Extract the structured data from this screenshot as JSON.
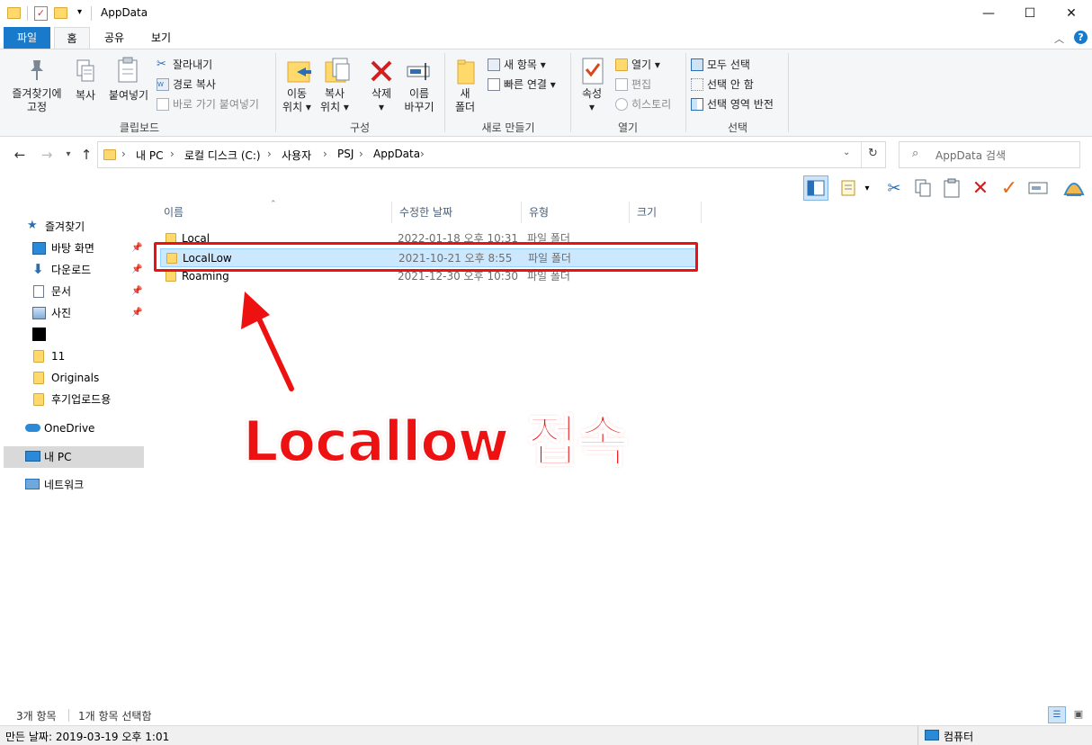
{
  "window": {
    "title": "AppData",
    "controls": {
      "minimize": "—",
      "maximize": "☐",
      "close": "✕"
    }
  },
  "ribbon_tabs": [
    {
      "label": "파일"
    },
    {
      "label": "홈"
    },
    {
      "label": "공유"
    },
    {
      "label": "보기"
    }
  ],
  "ribbon": {
    "clipboard": {
      "pin_label": "즐겨찾기에\n고정",
      "copy_label": "복사",
      "paste_label": "붙여넣기",
      "cut_label": "잘라내기",
      "copy_path_label": "경로 복사",
      "paste_shortcut_label": "바로 가기 붙여넣기",
      "group_label": "클립보드"
    },
    "organize": {
      "move_label": "이동\n위치 ▾",
      "copyto_label": "복사\n위치 ▾",
      "delete_label": "삭제\n▾",
      "rename_label": "이름\n바꾸기",
      "group_label": "구성"
    },
    "new": {
      "new_folder_label": "새\n폴더",
      "new_item_label": "새 항목 ▾",
      "easy_access_label": "빠른 연결 ▾",
      "group_label": "새로 만들기"
    },
    "open": {
      "properties_label": "속성\n▾",
      "open_label": "열기 ▾",
      "edit_label": "편집",
      "history_label": "히스토리",
      "group_label": "열기"
    },
    "select": {
      "select_all_label": "모두 선택",
      "select_none_label": "선택 안 함",
      "invert_label": "선택 영역 반전",
      "group_label": "선택"
    }
  },
  "address": {
    "crumbs": [
      "내 PC",
      "로컬 디스크 (C:)",
      "사용자",
      "PSJ",
      "AppData"
    ],
    "search_placeholder": "AppData 검색"
  },
  "sidebar": {
    "quick_access": "즐겨찾기",
    "items": [
      {
        "label": "바탕 화면",
        "pinned": true
      },
      {
        "label": "다운로드",
        "pinned": true
      },
      {
        "label": "문서",
        "pinned": true
      },
      {
        "label": "사진",
        "pinned": true
      },
      {
        "label": ""
      },
      {
        "label": "11"
      },
      {
        "label": "Originals"
      },
      {
        "label": "후기업로드용"
      }
    ],
    "onedrive": "OneDrive",
    "thispc": "내 PC",
    "network": "네트워크"
  },
  "columns": {
    "name": "이름",
    "date": "수정한 날짜",
    "type": "유형",
    "size": "크기"
  },
  "files": [
    {
      "name": "Local",
      "date": "2022-01-18 오후 10:31",
      "type": "파일 폴더"
    },
    {
      "name": "LocalLow",
      "date": "2021-10-21 오후 8:55",
      "type": "파일 폴더",
      "selected": true
    },
    {
      "name": "Roaming",
      "date": "2021-12-30 오후 10:30",
      "type": "파일 폴더"
    }
  ],
  "status": {
    "count": "3개 항목",
    "selected": "1개 항목 선택함"
  },
  "details": {
    "created": "만든 날짜: 2019-03-19 오후 1:01",
    "location": "컴퓨터"
  },
  "annotation": {
    "text": "Locallow 접속"
  },
  "colors": {
    "accent": "#1979ca",
    "selection": "#cce8ff",
    "annotation": "#ee1111",
    "folder": "#ffd96b"
  }
}
